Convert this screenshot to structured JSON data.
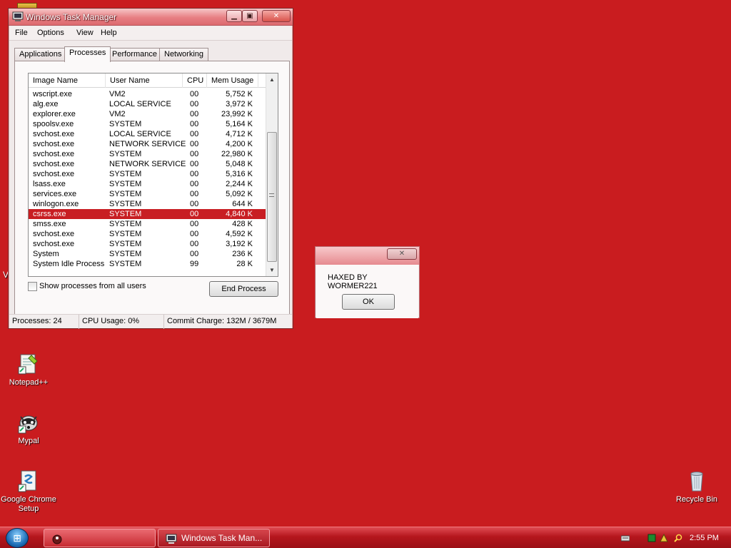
{
  "desktop": {
    "icons": [
      {
        "label": "Notepad++"
      },
      {
        "label": "Mypal"
      },
      {
        "label": "Google Chrome Setup"
      },
      {
        "label": "Recycle Bin"
      }
    ],
    "edge_letter": "V"
  },
  "task_manager": {
    "title": "Windows Task Manager",
    "menu": [
      "File",
      "Options",
      "View",
      "Help"
    ],
    "tabs": [
      "Applications",
      "Processes",
      "Performance",
      "Networking"
    ],
    "active_tab": "Processes",
    "columns": [
      "Image Name",
      "User Name",
      "CPU",
      "Mem Usage"
    ],
    "processes": [
      {
        "image": "wscript.exe",
        "user": "VM2",
        "cpu": "00",
        "mem": "5,752 K"
      },
      {
        "image": "alg.exe",
        "user": "LOCAL SERVICE",
        "cpu": "00",
        "mem": "3,972 K"
      },
      {
        "image": "explorer.exe",
        "user": "VM2",
        "cpu": "00",
        "mem": "23,992 K"
      },
      {
        "image": "spoolsv.exe",
        "user": "SYSTEM",
        "cpu": "00",
        "mem": "5,164 K"
      },
      {
        "image": "svchost.exe",
        "user": "LOCAL SERVICE",
        "cpu": "00",
        "mem": "4,712 K"
      },
      {
        "image": "svchost.exe",
        "user": "NETWORK SERVICE",
        "cpu": "00",
        "mem": "4,200 K"
      },
      {
        "image": "svchost.exe",
        "user": "SYSTEM",
        "cpu": "00",
        "mem": "22,980 K"
      },
      {
        "image": "svchost.exe",
        "user": "NETWORK SERVICE",
        "cpu": "00",
        "mem": "5,048 K"
      },
      {
        "image": "svchost.exe",
        "user": "SYSTEM",
        "cpu": "00",
        "mem": "5,316 K"
      },
      {
        "image": "lsass.exe",
        "user": "SYSTEM",
        "cpu": "00",
        "mem": "2,244 K"
      },
      {
        "image": "services.exe",
        "user": "SYSTEM",
        "cpu": "00",
        "mem": "5,092 K"
      },
      {
        "image": "winlogon.exe",
        "user": "SYSTEM",
        "cpu": "00",
        "mem": "644 K"
      },
      {
        "image": "csrss.exe",
        "user": "SYSTEM",
        "cpu": "00",
        "mem": "4,840 K",
        "selected": true
      },
      {
        "image": "smss.exe",
        "user": "SYSTEM",
        "cpu": "00",
        "mem": "428 K"
      },
      {
        "image": "svchost.exe",
        "user": "SYSTEM",
        "cpu": "00",
        "mem": "4,592 K"
      },
      {
        "image": "svchost.exe",
        "user": "SYSTEM",
        "cpu": "00",
        "mem": "3,192 K"
      },
      {
        "image": "System",
        "user": "SYSTEM",
        "cpu": "00",
        "mem": "236 K"
      },
      {
        "image": "System Idle Process",
        "user": "SYSTEM",
        "cpu": "99",
        "mem": "28 K"
      }
    ],
    "show_all_users_label": "Show processes from all users",
    "show_all_users_checked": false,
    "end_process_label": "End Process",
    "status": {
      "processes": "Processes: 24",
      "cpu": "CPU Usage: 0%",
      "commit": "Commit Charge: 132M / 3679M"
    }
  },
  "message_box": {
    "text": "HAXED BY WORMER221",
    "ok_label": "OK"
  },
  "taskbar": {
    "buttons": [
      {
        "label": "",
        "icon": "app-icon"
      },
      {
        "label": "Windows Task Man...",
        "icon": "task-manager-icon",
        "active": true
      }
    ],
    "clock": "2:55 PM"
  },
  "colors": {
    "desktop_bg": "#c91c1f",
    "selection": "#c81e23",
    "taskbar": "#b5161d"
  }
}
